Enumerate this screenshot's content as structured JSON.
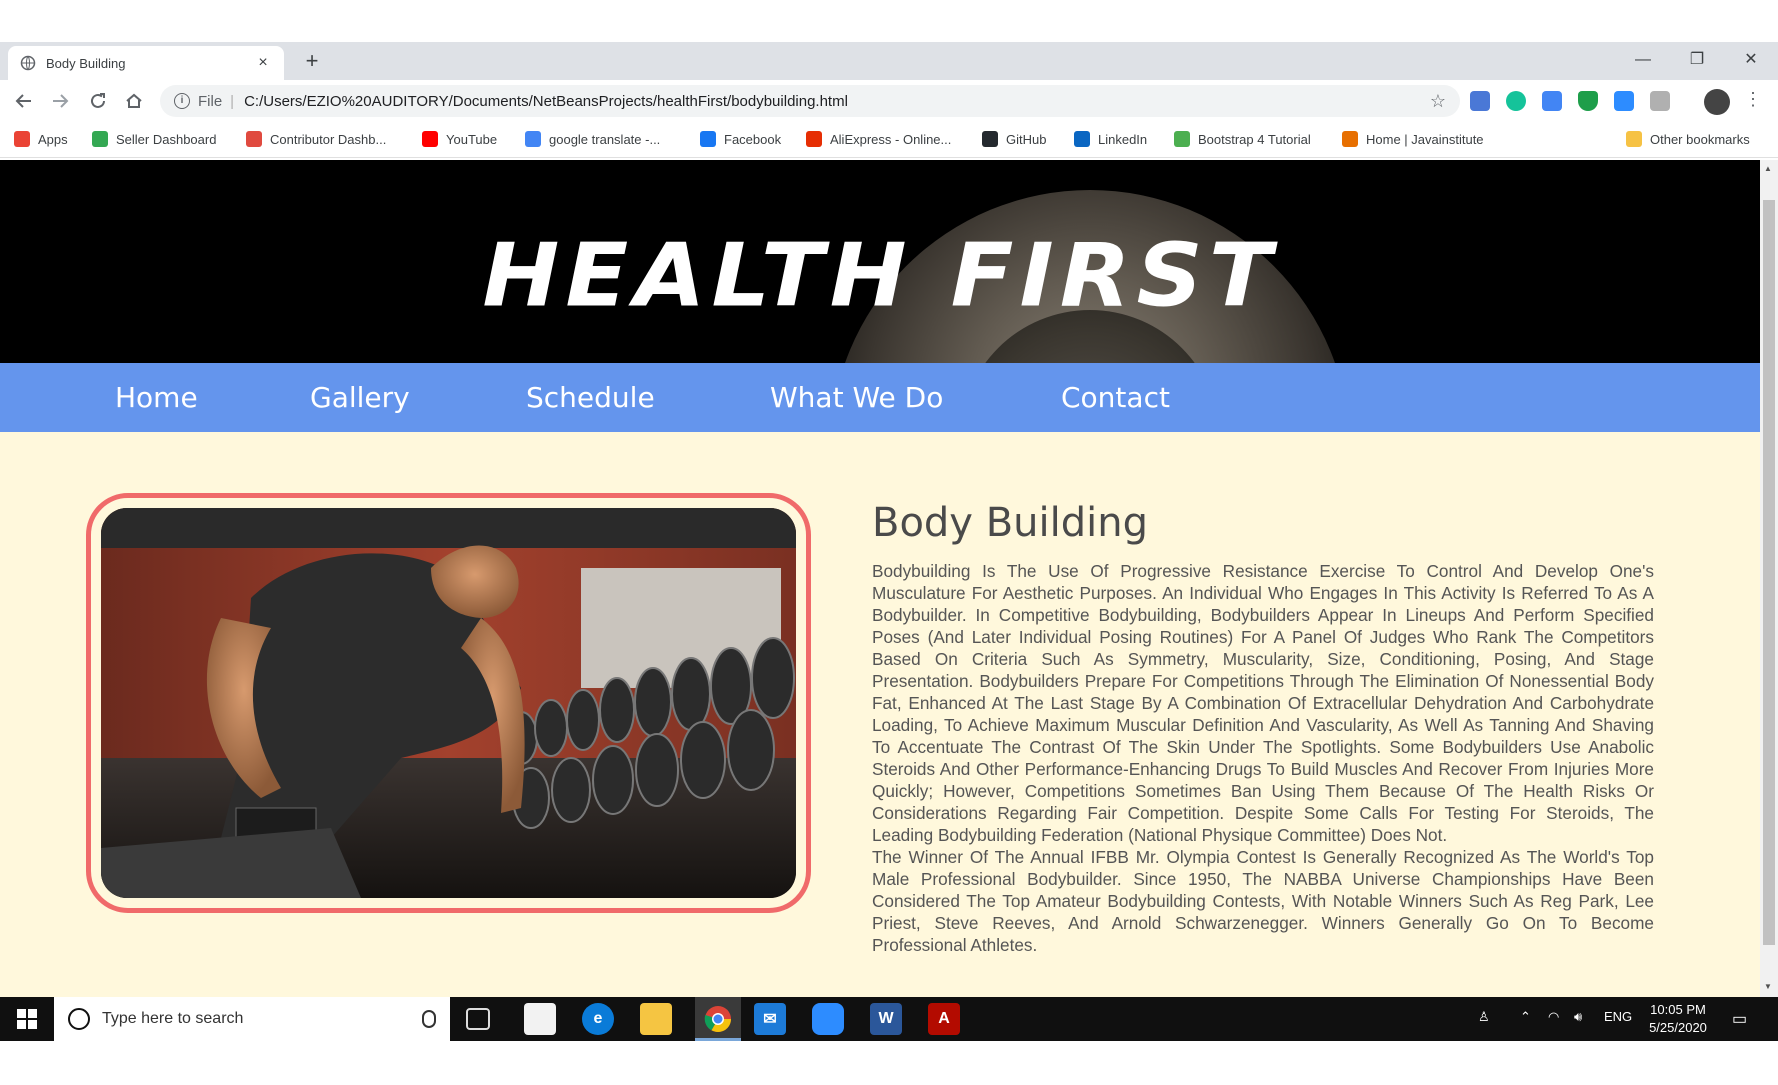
{
  "browser": {
    "tab_title": "Body Building",
    "tab_close": "×",
    "new_tab": "+",
    "scheme": "File",
    "url": "C:/Users/EZIO%20AUDITORY/Documents/NetBeansProjects/healthFirst/bodybuilding.html",
    "window_controls": {
      "minimize": "—",
      "restore": "❐",
      "close": "✕"
    }
  },
  "bookmarks": [
    {
      "label": "Apps",
      "icon": "apps-grid-icon",
      "color": "#ea4335"
    },
    {
      "label": "Seller Dashboard",
      "icon": "seller-icon",
      "color": "#34a853"
    },
    {
      "label": "Contributor Dashb...",
      "icon": "contributor-icon",
      "color": "#e04a3f"
    },
    {
      "label": "YouTube",
      "icon": "youtube-icon",
      "color": "#ff0000"
    },
    {
      "label": "google translate -...",
      "icon": "google-icon",
      "color": "#4285f4"
    },
    {
      "label": "Facebook",
      "icon": "facebook-icon",
      "color": "#1877f2"
    },
    {
      "label": "AliExpress - Online...",
      "icon": "aliexpress-icon",
      "color": "#e62e04"
    },
    {
      "label": "GitHub",
      "icon": "github-icon",
      "color": "#24292e"
    },
    {
      "label": "LinkedIn",
      "icon": "linkedin-icon",
      "color": "#0a66c2"
    },
    {
      "label": "Bootstrap 4 Tutorial",
      "icon": "w3-icon",
      "color": "#4caf50"
    },
    {
      "label": "Home | Javainstitute",
      "icon": "java-icon",
      "color": "#e76f00"
    },
    {
      "label": "Other bookmarks",
      "icon": "folder-icon",
      "color": "#f6c244"
    }
  ],
  "site": {
    "logo": "HEALTH FIRST",
    "nav": [
      "Home",
      "Gallery",
      "Schedule",
      "What We Do",
      "Contact"
    ],
    "nav_color": "#6495ed",
    "background": "#fff8dc",
    "frame_color": "#f06a6a"
  },
  "article": {
    "title": "Body Building",
    "paragraph1": "Bodybuilding Is The Use Of Progressive Resistance Exercise To Control And Develop One's Musculature For Aesthetic Purposes. An Individual Who Engages In This Activity Is Referred To As A Bodybuilder. In Competitive Bodybuilding, Bodybuilders Appear In Lineups And Perform Specified Poses (And Later Individual Posing Routines) For A Panel Of Judges Who Rank The Competitors Based On Criteria Such As Symmetry, Muscularity, Size, Conditioning, Posing, And Stage Presentation. Bodybuilders Prepare For Competitions Through The Elimination Of Nonessential Body Fat, Enhanced At The Last Stage By A Combination Of Extracellular Dehydration And Carbohydrate Loading, To Achieve Maximum Muscular Definition And Vascularity, As Well As Tanning And Shaving To Accentuate The Contrast Of The Skin Under The Spotlights. Some Bodybuilders Use Anabolic Steroids And Other Performance-Enhancing Drugs To Build Muscles And Recover From Injuries More Quickly; However, Competitions Sometimes Ban Using Them Because Of The Health Risks Or Considerations Regarding Fair Competition. Despite Some Calls For Testing For Steroids, The Leading Bodybuilding Federation (National Physique Committee) Does Not.",
    "paragraph2": "The Winner Of The Annual IFBB Mr. Olympia Contest Is Generally Recognized As The World's Top Male Professional Bodybuilder. Since 1950, The NABBA Universe Championships Have Been Considered The Top Amateur Bodybuilding Contests, With Notable Winners Such As Reg Park, Lee Priest, Steve Reeves, And Arnold Schwarzenegger. Winners Generally Go On To Become Professional Athletes."
  },
  "taskbar": {
    "search_placeholder": "Type here to search",
    "language": "ENG",
    "time": "10:05 PM",
    "date": "5/25/2020"
  }
}
